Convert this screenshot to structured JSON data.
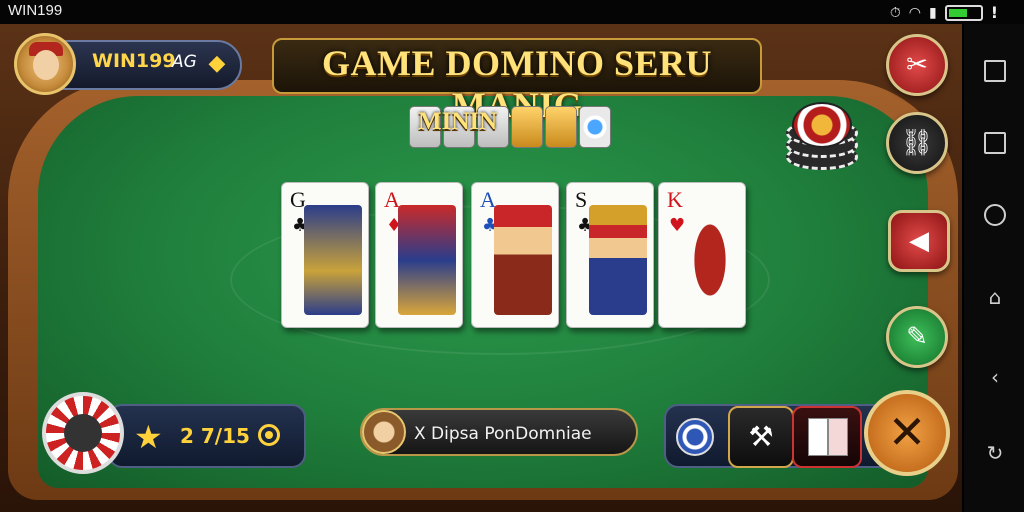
{
  "status_bar": {
    "carrier": "WIN199"
  },
  "player": {
    "name": "WIN199",
    "extra": "AG"
  },
  "title": "GAME DOMINO SERU MANIG",
  "domino_row_label": "MININ",
  "cards": [
    {
      "rank": "G",
      "suit": "♣",
      "rank_color": "black"
    },
    {
      "rank": "A",
      "suit": "♦",
      "rank_color": "red"
    },
    {
      "rank": "A",
      "suit": "♣",
      "rank_color": "blue"
    },
    {
      "rank": "S",
      "suit": "♣",
      "rank_color": "black"
    },
    {
      "rank": "K",
      "suit": "♥",
      "rank_color": "red"
    }
  ],
  "hud": {
    "score": "2 7/15",
    "message": "X Dipsa PonDomniae"
  },
  "colors": {
    "felt": "#1f7d3b",
    "gold": "#ffd54a",
    "red": "#d1141b"
  },
  "icons": [
    "shuffle-icon",
    "link-icon",
    "back-icon",
    "chat-icon",
    "star-icon",
    "coin-icon",
    "close-icon"
  ]
}
